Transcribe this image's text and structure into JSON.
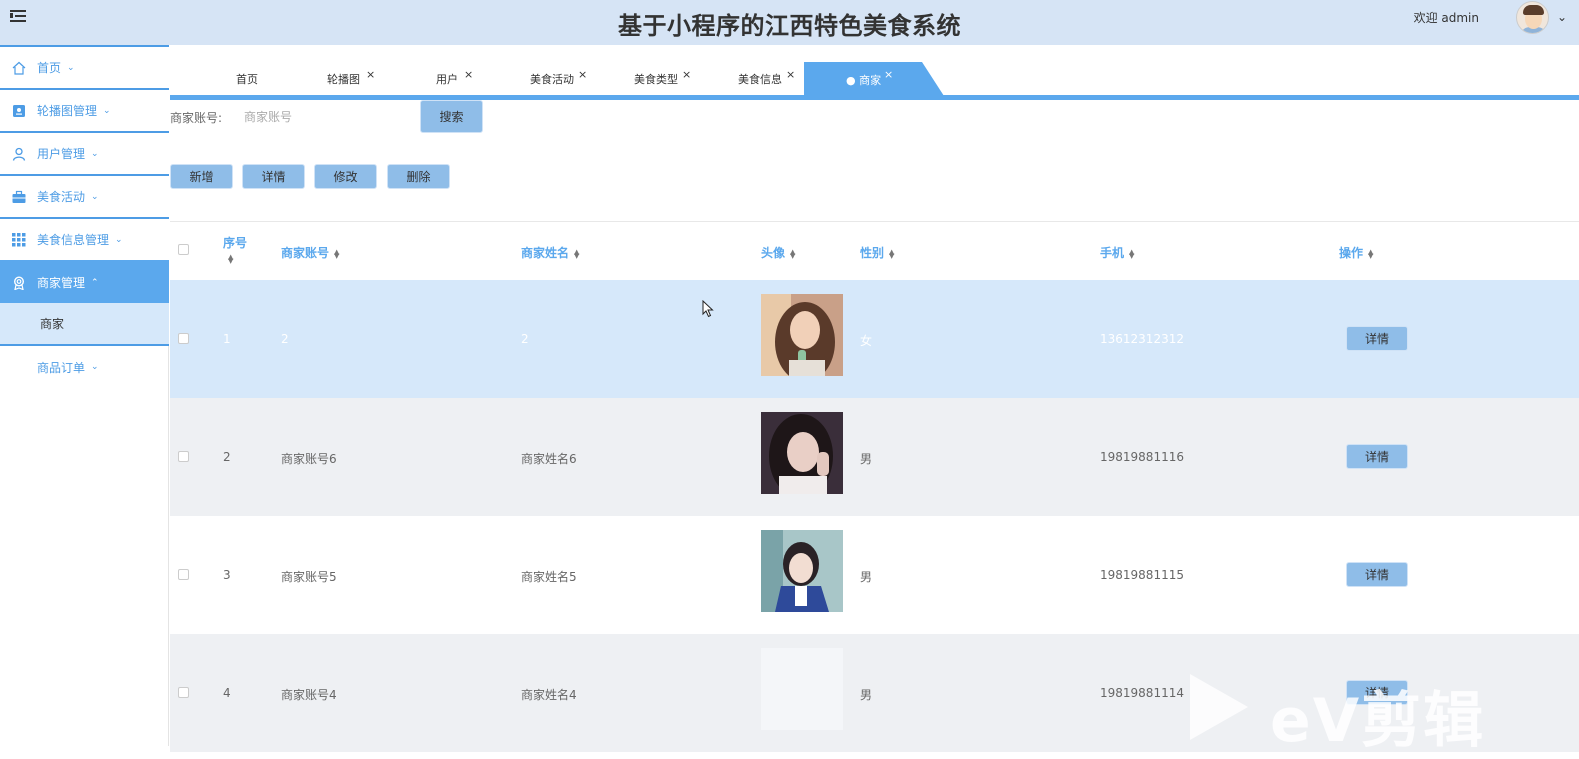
{
  "header": {
    "title": "基于小程序的江西特色美食系统",
    "welcome": "欢迎 admin"
  },
  "sidebar": {
    "items": [
      {
        "label": "首页",
        "icon": "home-icon"
      },
      {
        "label": "轮播图管理",
        "icon": "picture-icon"
      },
      {
        "label": "用户管理",
        "icon": "user-icon"
      },
      {
        "label": "美食活动",
        "icon": "briefcase-icon"
      },
      {
        "label": "美食信息管理",
        "icon": "grid-icon"
      },
      {
        "label": "商家管理",
        "icon": "badge-icon"
      }
    ],
    "sub_item": "商家",
    "order_item": "商品订单"
  },
  "tabs": [
    {
      "label": "首页"
    },
    {
      "label": "轮播图"
    },
    {
      "label": "用户"
    },
    {
      "label": "美食活动"
    },
    {
      "label": "美食类型"
    },
    {
      "label": "美食信息"
    },
    {
      "label": "● 商家"
    }
  ],
  "search": {
    "label": "商家账号:",
    "placeholder": "商家账号",
    "button": "搜索"
  },
  "actions": {
    "add": "新增",
    "detail": "详情",
    "edit": "修改",
    "delete": "删除"
  },
  "table": {
    "columns": [
      "序号",
      "商家账号",
      "商家姓名",
      "头像",
      "性别",
      "手机",
      "操作"
    ],
    "rows": [
      {
        "no": "1",
        "account": "2",
        "name": "2",
        "gender": "女",
        "phone": "13612312312",
        "op": "详情"
      },
      {
        "no": "2",
        "account": "商家账号6",
        "name": "商家姓名6",
        "gender": "男",
        "phone": "19819881116",
        "op": "详情"
      },
      {
        "no": "3",
        "account": "商家账号5",
        "name": "商家姓名5",
        "gender": "男",
        "phone": "19819881115",
        "op": "详情"
      },
      {
        "no": "4",
        "account": "商家账号4",
        "name": "商家姓名4",
        "gender": "男",
        "phone": "19819881114",
        "op": "详情"
      }
    ]
  },
  "watermark": "eV剪辑",
  "colors": {
    "accent": "#5ba8ed",
    "header_bg": "#d6e4f5",
    "button_bg": "#8fbde8",
    "selected_row": "#d6e8fa"
  }
}
